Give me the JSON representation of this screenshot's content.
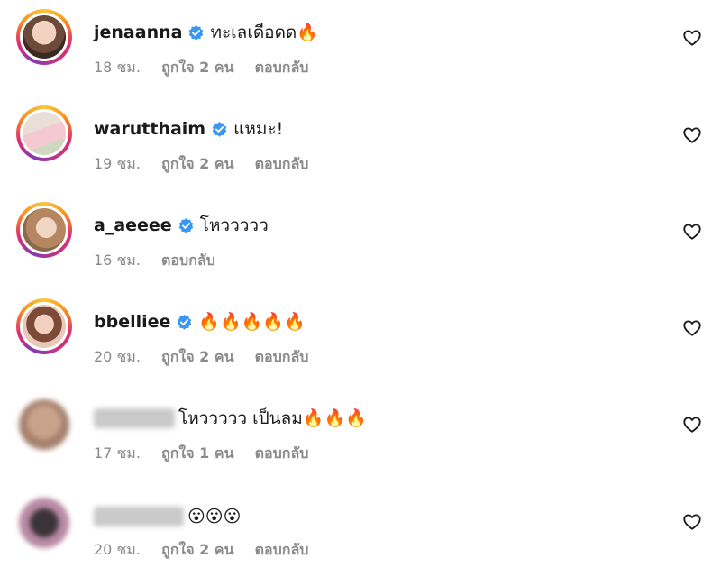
{
  "colors": {
    "verified": "#3897f0",
    "meta_text": "#8a8a8a",
    "username_text": "#1a1a1a"
  },
  "comments": [
    {
      "username": "jenaanna",
      "verified": true,
      "text": "ทะเลเดือดด🔥",
      "time": "18 ชม.",
      "likes": "ถูกใจ 2 คน",
      "reply": "ตอบกลับ"
    },
    {
      "username": "warutthaim",
      "verified": true,
      "text": "แหมะ!",
      "time": "19 ชม.",
      "likes": "ถูกใจ 2 คน",
      "reply": "ตอบกลับ"
    },
    {
      "username": "a_aeeee",
      "verified": true,
      "text": "โหววววว",
      "time": "16 ชม.",
      "likes": "",
      "reply": "ตอบกลับ"
    },
    {
      "username": "bbelliee",
      "verified": true,
      "text": "🔥🔥🔥🔥🔥",
      "time": "20 ชม.",
      "likes": "ถูกใจ 2 คน",
      "reply": "ตอบกลับ"
    },
    {
      "username": "",
      "verified": false,
      "text": "โหววววว เป็นลม🔥🔥🔥",
      "time": "17 ชม.",
      "likes": "ถูกใจ 1 คน",
      "reply": "ตอบกลับ"
    },
    {
      "username": "",
      "verified": false,
      "text": "😮😮😮",
      "time": "20 ชม.",
      "likes": "ถูกใจ 2 คน",
      "reply": "ตอบกลับ"
    }
  ],
  "icons": {
    "like": "heart-icon",
    "verified": "verified-badge-icon"
  }
}
